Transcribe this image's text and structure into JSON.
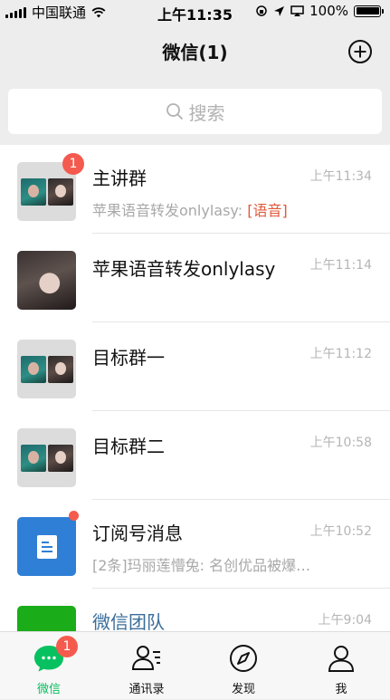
{
  "status_bar": {
    "carrier": "中国联通",
    "time": "上午11:35",
    "battery": "100%",
    "battery_level": 1.0
  },
  "nav": {
    "title": "微信(1)",
    "add_icon": "plus-circle-icon"
  },
  "search": {
    "placeholder": "搜索",
    "icon": "search-icon"
  },
  "chats": [
    {
      "name": "主讲群",
      "time": "上午11:34",
      "preview": "苹果语音转发onlylasy: ",
      "preview_tag": "[语音]",
      "badge": "1",
      "avatar": "group-avatar"
    },
    {
      "name": "苹果语音转发onlylasy",
      "time": "上午11:14",
      "preview": "",
      "preview_tag": "",
      "badge": "",
      "avatar": "photo-avatar"
    },
    {
      "name": "目标群一",
      "time": "上午11:12",
      "preview": "",
      "preview_tag": "",
      "badge": "",
      "avatar": "group-avatar"
    },
    {
      "name": "目标群二",
      "time": "上午10:58",
      "preview": "",
      "preview_tag": "",
      "badge": "",
      "avatar": "group-avatar"
    },
    {
      "name": "订阅号消息",
      "time": "上午10:52",
      "preview": "[2条]玛丽莲懵兔: 名创优品被爆…",
      "preview_tag": "",
      "badge": "dot",
      "avatar": "subscription-avatar"
    },
    {
      "name": "微信团队",
      "time": "上午9:04",
      "preview": "",
      "preview_tag": "",
      "badge": "",
      "avatar": "wechat-team-avatar"
    }
  ],
  "tabbar": {
    "tabs": [
      {
        "label": "微信",
        "icon": "chat-bubble-icon",
        "badge": "1",
        "active": true
      },
      {
        "label": "通讯录",
        "icon": "contacts-icon",
        "badge": "",
        "active": false
      },
      {
        "label": "发现",
        "icon": "compass-icon",
        "badge": "",
        "active": false
      },
      {
        "label": "我",
        "icon": "person-icon",
        "badge": "",
        "active": false
      }
    ]
  },
  "colors": {
    "accent": "#07c160",
    "badge": "#f55a4e",
    "voice_tag": "#e05a3c",
    "background": "#ededed"
  }
}
